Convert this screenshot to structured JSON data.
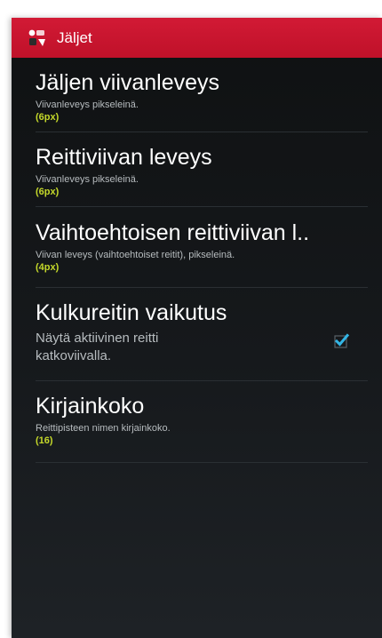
{
  "header": {
    "title": "Jäljet",
    "icon": "app-logo-icon",
    "color": "#c8142e"
  },
  "preferences": [
    {
      "title": "Jäljen viivanleveys",
      "summary": "Viivanleveys pikseleinä.",
      "value": "(6px)"
    },
    {
      "title": "Reittiviivan leveys",
      "summary": "Viivanleveys pikseleinä.",
      "value": "(6px)"
    },
    {
      "title": "Vaihtoehtoisen reittiviivan l..",
      "summary": "Viivan leveys (vaihtoehtoiset reitit), pikseleinä.",
      "value": "(4px)"
    },
    {
      "title": "Kulkureitin vaikutus",
      "summary_line1": "Näytä aktiivinen reitti",
      "summary_line2": "katkoviivalla.",
      "checked": true
    },
    {
      "title": "Kirjainkoko",
      "summary": "Reittipisteen nimen kirjainkoko.",
      "value": "(16)"
    }
  ],
  "colors": {
    "accent_value": "#c4d82a",
    "checkbox": "#33b5e5"
  }
}
